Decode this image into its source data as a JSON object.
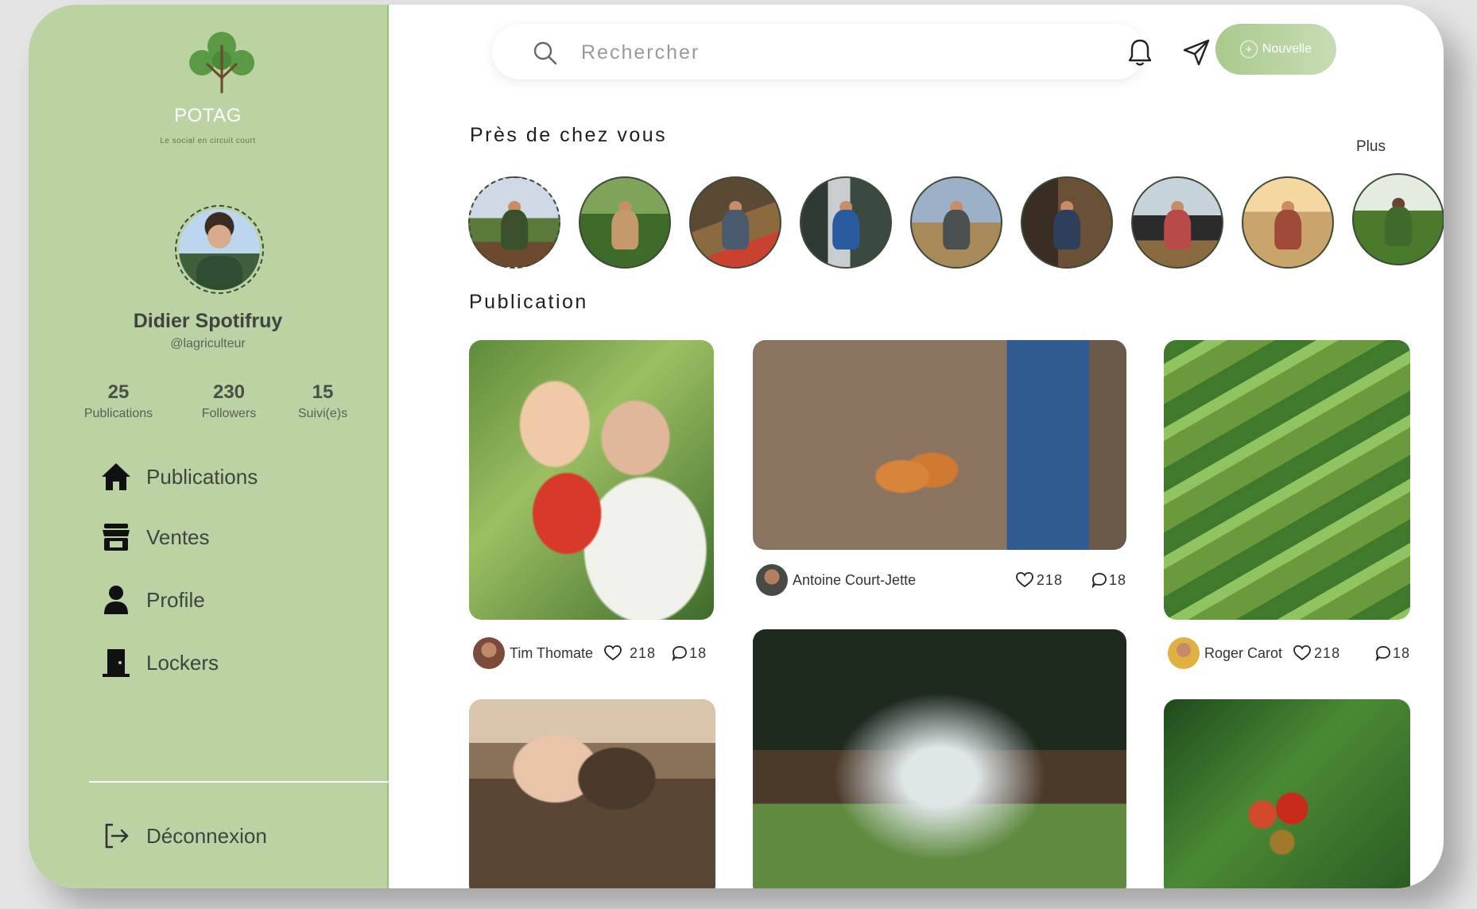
{
  "brand": {
    "name": "POTAG",
    "tagline": "Le social en circuit court"
  },
  "profile": {
    "name": "Didier Spotifruy",
    "handle": "@lagriculteur",
    "stats": [
      {
        "value": "25",
        "label": "Publications"
      },
      {
        "value": "230",
        "label": "Followers"
      },
      {
        "value": "15",
        "label": "Suivi(e)s"
      }
    ]
  },
  "nav": [
    {
      "label": "Publications",
      "icon": "home-icon"
    },
    {
      "label": "Ventes",
      "icon": "store-icon"
    },
    {
      "label": "Profile",
      "icon": "user-icon"
    },
    {
      "label": "Lockers",
      "icon": "door-icon"
    }
  ],
  "logout": {
    "label": "Déconnexion",
    "icon": "logout-icon"
  },
  "search": {
    "placeholder": "Rechercher"
  },
  "header": {
    "new_label": "Nouvelle",
    "icons": [
      "bell-icon",
      "send-icon"
    ]
  },
  "nearby": {
    "title": "Près de chez vous",
    "more": "Plus"
  },
  "feed": {
    "title": "Publication",
    "posts": [
      {
        "author": "Tim Thomate",
        "likes": "218",
        "comments": "18"
      },
      {
        "author": "Antoine Court-Jette",
        "likes": "218",
        "comments": "18"
      },
      {
        "author": "Roger Carot",
        "likes": "218",
        "comments": "18"
      }
    ]
  },
  "colors": {
    "sidebar": "#bbd3a3",
    "accent": "#a9ca8d",
    "logo_green": "#5a9a45"
  }
}
